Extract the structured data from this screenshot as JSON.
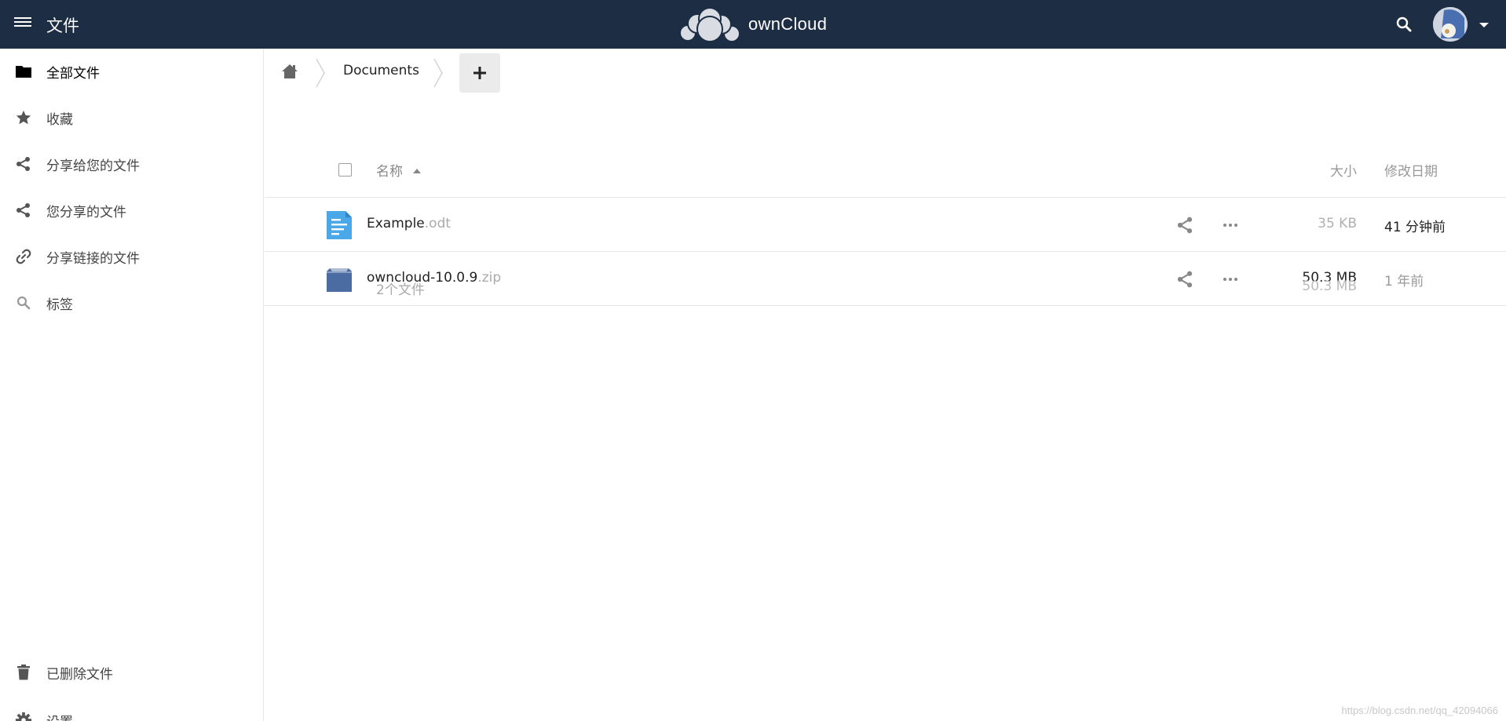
{
  "header": {
    "app_title": "文件",
    "brand_name": "ownCloud",
    "brand_color": "#1d2d44"
  },
  "sidebar": {
    "items": [
      {
        "label": "全部文件",
        "icon": "folder-icon",
        "active": true
      },
      {
        "label": "收藏",
        "icon": "star-icon"
      },
      {
        "label": "分享给您的文件",
        "icon": "share-icon"
      },
      {
        "label": "您分享的文件",
        "icon": "share-icon"
      },
      {
        "label": "分享链接的文件",
        "icon": "link-icon"
      },
      {
        "label": "标签",
        "icon": "search-icon"
      }
    ],
    "bottom": [
      {
        "label": "已删除文件",
        "icon": "trash-icon"
      },
      {
        "label": "设置",
        "icon": "gear-icon"
      }
    ]
  },
  "breadcrumb": {
    "current": "Documents"
  },
  "table": {
    "headers": {
      "name": "名称",
      "size": "大小",
      "date": "修改日期"
    },
    "rows": [
      {
        "name": "Example",
        "ext": ".odt",
        "size": "35 KB",
        "date": "41 分钟前",
        "icon": "document-icon"
      },
      {
        "name": "owncloud-10.0.9",
        "ext": ".zip",
        "size": "50.3 MB",
        "date": "1 年前",
        "icon": "archive-icon"
      }
    ],
    "summary": {
      "count": "2个文件",
      "total_size": "50.3 MB"
    }
  },
  "watermark": "https://blog.csdn.net/qq_42094066"
}
